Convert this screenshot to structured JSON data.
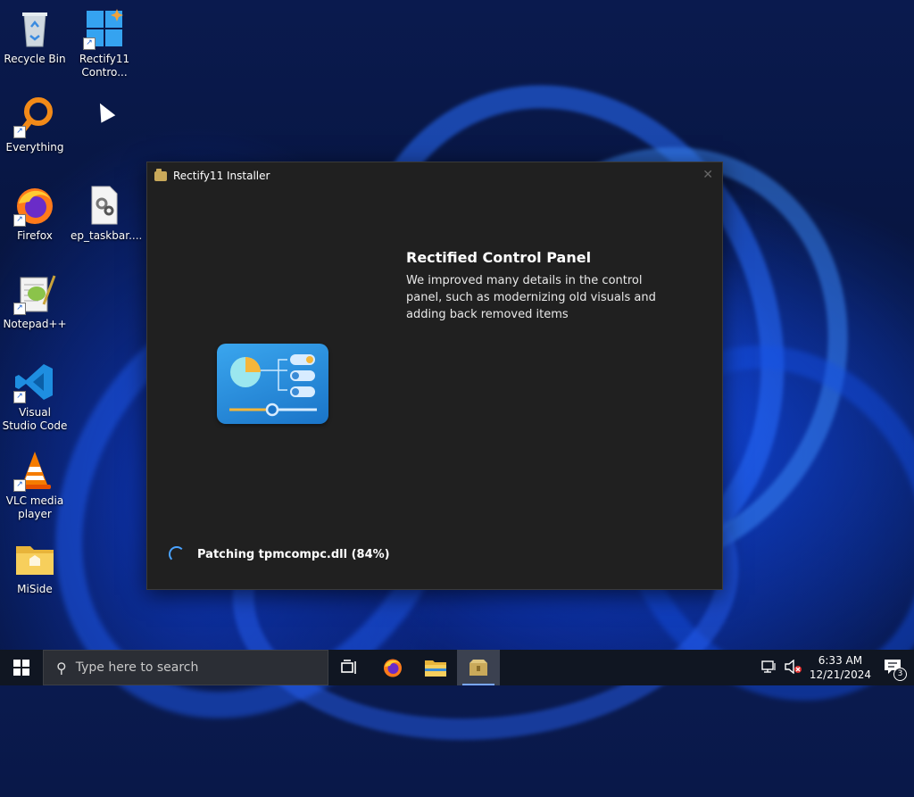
{
  "desktop": {
    "icons": [
      {
        "label": "Recycle Bin"
      },
      {
        "label": "Rectify11 Contro..."
      },
      {
        "label": "Everything"
      },
      {
        "label": "Firefox"
      },
      {
        "label": "ep_taskbar...."
      },
      {
        "label": "Notepad++"
      },
      {
        "label": "Visual Studio Code"
      },
      {
        "label": "VLC media player"
      },
      {
        "label": "MiSide"
      }
    ]
  },
  "installer": {
    "title": "Rectify11 Installer",
    "close_glyph": "✕",
    "heading": "Rectified Control Panel",
    "description": "We improved many details in the control panel, such as modernizing old visuals and adding back removed items",
    "status": "Patching tpmcompc.dll (84%)",
    "progress_percent": 84
  },
  "taskbar": {
    "search_placeholder": "Type here to search",
    "time": "6:33 AM",
    "date": "12/21/2024",
    "notification_count": "3"
  }
}
